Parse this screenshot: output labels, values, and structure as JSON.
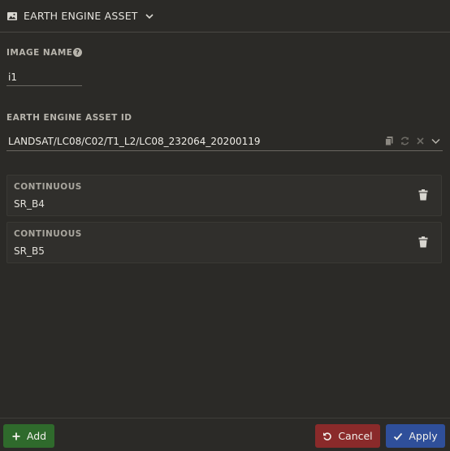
{
  "header": {
    "title": "EARTH ENGINE ASSET"
  },
  "image_name": {
    "label": "IMAGE NAME",
    "value": "i1"
  },
  "asset_id": {
    "label": "EARTH ENGINE ASSET ID",
    "value": "LANDSAT/LC08/C02/T1_L2/LC08_232064_20200119"
  },
  "bands": [
    {
      "type": "CONTINUOUS",
      "name": "SR_B4"
    },
    {
      "type": "CONTINUOUS",
      "name": "SR_B5"
    }
  ],
  "footer": {
    "add_label": "Add",
    "cancel_label": "Cancel",
    "apply_label": "Apply"
  },
  "colors": {
    "add": "#2f6a2c",
    "cancel": "#8a2a2a",
    "apply": "#2f4f9a",
    "background": "#2b2a27"
  },
  "icons": [
    "image-icon",
    "chevron-down-icon",
    "help-icon",
    "copy-icon",
    "refresh-icon",
    "clear-icon",
    "trash-icon",
    "plus-icon",
    "undo-icon",
    "check-icon"
  ]
}
